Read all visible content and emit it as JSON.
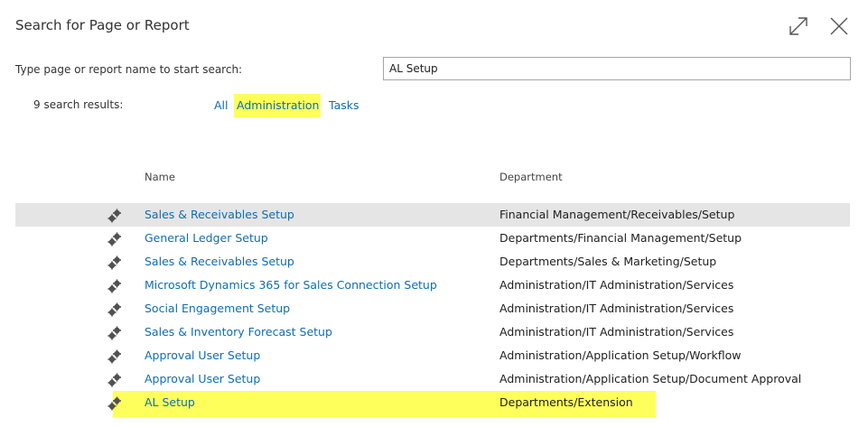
{
  "dialog": {
    "title": "Search for Page or Report"
  },
  "search": {
    "label": "Type page or report name to start search:",
    "value": "AL Setup"
  },
  "results": {
    "count_label": "9 search results:",
    "filters": [
      "All",
      "Administration",
      "Tasks"
    ],
    "active_filter": "Administration",
    "highlight_color": "#ffff5c",
    "link_color": "#0e6db5"
  },
  "table": {
    "headers": {
      "name": "Name",
      "department": "Department"
    },
    "rows": [
      {
        "icon": "gears-icon",
        "name": "Sales & Receivables Setup",
        "department": "Financial Management/Receivables/Setup"
      },
      {
        "icon": "gears-icon",
        "name": "General Ledger Setup",
        "department": "Departments/Financial Management/Setup"
      },
      {
        "icon": "gears-icon",
        "name": "Sales & Receivables Setup",
        "department": "Departments/Sales & Marketing/Setup"
      },
      {
        "icon": "gears-icon",
        "name": "Microsoft Dynamics 365 for Sales Connection Setup",
        "department": "Administration/IT Administration/Services"
      },
      {
        "icon": "gears-icon",
        "name": "Social Engagement Setup",
        "department": "Administration/IT Administration/Services"
      },
      {
        "icon": "gears-icon",
        "name": "Sales & Inventory Forecast Setup",
        "department": "Administration/IT Administration/Services"
      },
      {
        "icon": "gears-icon",
        "name": "Approval User Setup",
        "department": "Administration/Application Setup/Workflow"
      },
      {
        "icon": "gears-icon",
        "name": "Approval User Setup",
        "department": "Administration/Application Setup/Document Approval"
      },
      {
        "icon": "gears-icon",
        "name": "AL Setup",
        "department": "Departments/Extension"
      }
    ]
  }
}
